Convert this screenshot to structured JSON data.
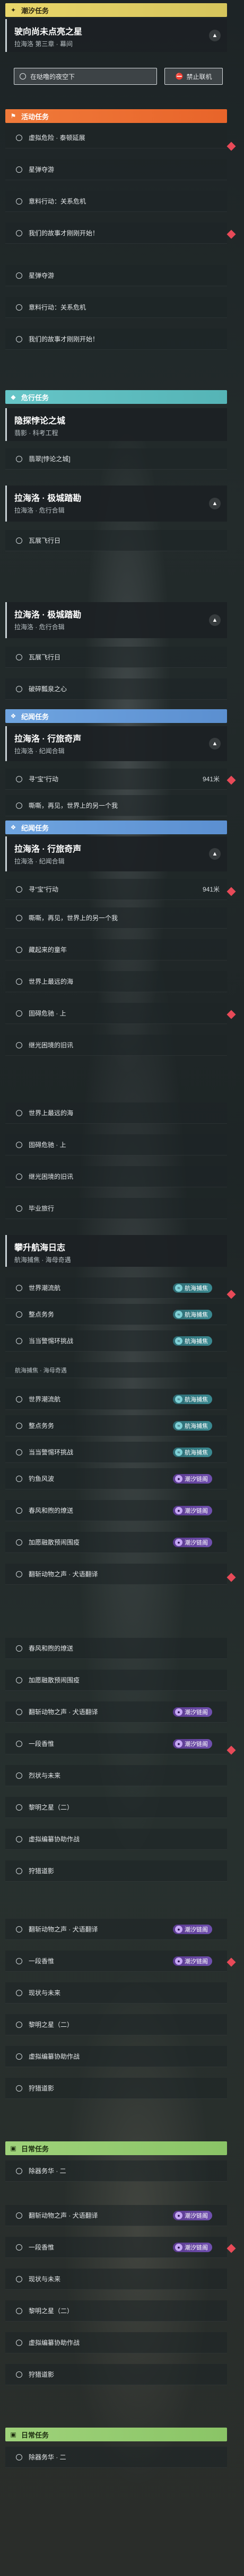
{
  "headers": {
    "main": "潮汐任务",
    "event": "活动任务",
    "dangerous": "危行任务",
    "journey": "纪闻任务",
    "journey_repeat": "纪闻任务",
    "daily": "日常任务",
    "daily_repeat": "日常任务"
  },
  "main_card": {
    "title": "驶向尚未点亮之星",
    "subtitle": "拉海洛 第三章 · 幕间"
  },
  "main_steps": {
    "item1": "在哒噜的夜空下",
    "sync": "禁止联机"
  },
  "event_rows": [
    "虚拟危险 · 泰顿延展",
    "星弹夺游",
    "意料行动：关系危机",
    "我们的故事才刚刚开始！"
  ],
  "event_rows_2": [
    "星弹夺游",
    "意料行动：关系危机",
    "我们的故事才刚刚开始！"
  ],
  "danger_cards": [
    {
      "title": "隐探悖论之城",
      "subtitle": "翡影 · 科考工程"
    },
    {
      "title": "拉海洛 · 极城踏勘",
      "subtitle": "拉海洛 · 危行合辑"
    },
    {
      "title": "拉海洛 · 极城踏勘",
      "subtitle": "拉海洛 · 危行合辑"
    }
  ],
  "danger_rows": {
    "a": "翡翠[悖论之城]",
    "b": "瓦展飞行日",
    "c": "瓦展飞行日",
    "d": "破碎瓢泉之心"
  },
  "journey_cards": [
    {
      "title": "拉海洛 · 行旅奇声",
      "subtitle": "拉海洛 · 纪闻合辑"
    },
    {
      "title": "拉海洛 · 行旅奇声",
      "subtitle": "拉海洛 · 纪闻合辑"
    }
  ],
  "journey_rows_1": {
    "item": "寻“宝”行动",
    "dist": "941米",
    "item2": "嘶嘶，再见，世界上的另一个我"
  },
  "journey_rows_2": [
    "寻“宝”行动",
    "嘶嘶，再见，世界上的另一个我",
    "藏起来的童年",
    "世界上最远的海",
    "固碍危驰 · 上",
    "继光困境的旧讯"
  ],
  "journey_rows_2_dist": "941米",
  "mid_rows": [
    "世界上最远的海",
    "固碍危驰 · 上",
    "继光困境的旧讯",
    "毕业旅行"
  ],
  "voyage_card": {
    "title": "攀升航海日志",
    "subtitle": "航海捕焦 · 海母奇遇"
  },
  "voyage_rows_1": [
    "世界潮流航",
    "整点务务",
    "当当警惕环挑战"
  ],
  "voyage_sub_title": "航海捕焦 · 海母奇遇",
  "voyage_rows_2": [
    "世界潮流航",
    "整点务务",
    "当当警惕环挑战",
    "钓鱼风波",
    "春风和煦的燎送",
    "加愿融散预闹围疫",
    "翻斩动物之声 · 犬语翻译"
  ],
  "late_rows": [
    "春风和煦的燎送",
    "加愿融散预闹围疫",
    "翻斩动物之声 · 犬语翻译",
    "一段香惟",
    "烈状与未来",
    "黎明之星（二）",
    "虚拟编纂协助作战",
    "狩猎道影"
  ],
  "late_rows_2": [
    "翻斩动物之声 · 犬语翻译",
    "一段香惟",
    "现状与未来",
    "黎明之星（二）",
    "虚拟编纂协助作战",
    "狩猎道影"
  ],
  "daily_rows": [
    "除器务华 · 二"
  ],
  "daily_extra": [
    "翻斩动物之声 · 犬语翻译",
    "一段香惟",
    "现状与未来",
    "黎明之星（二）",
    "虚拟编纂协助作战",
    "狩猎道影"
  ],
  "daily_rows_2": [
    "除器务华 · 二"
  ],
  "badges": {
    "hang": "航海捕焦",
    "xi": "潮汐链阁"
  }
}
